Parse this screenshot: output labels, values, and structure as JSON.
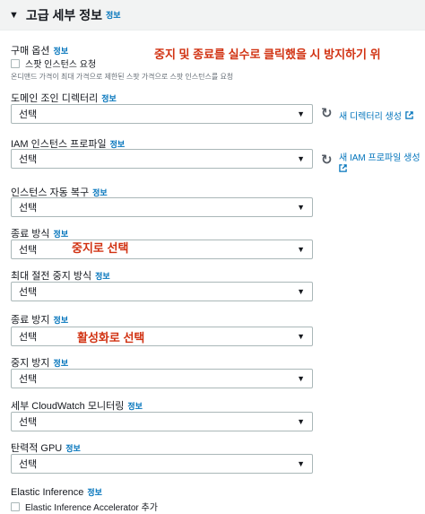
{
  "section": {
    "title": "고급 세부 정보",
    "info": "정보"
  },
  "purchase_option": {
    "label": "구매 옵션",
    "info": "정보",
    "checkbox_label": "스팟 인스턴스 요청",
    "description": "온디맨드 가격이 최대 가격으로 제한된 스팟 가격으로 스팟 인스턴스를 요청"
  },
  "annotation_top": "중지 및 종료를 실수로 클릭했을 시 방지하기 위",
  "domain_join": {
    "label": "도메인 조인 디렉터리",
    "info": "정보",
    "value": "선택",
    "new_link": "새 디렉터리 생성"
  },
  "iam_profile": {
    "label": "IAM 인스턴스 프로파일",
    "info": "정보",
    "value": "선택",
    "new_link": "새 IAM 프로파일 생성"
  },
  "auto_recovery": {
    "label": "인스턴스 자동 복구",
    "info": "정보",
    "value": "선택"
  },
  "shutdown_behavior": {
    "label": "종료 방식",
    "info": "정보",
    "value": "선택",
    "annotation": "중지로 선택"
  },
  "hibernate_behavior": {
    "label": "최대 절전 중지 방식",
    "info": "정보",
    "value": "선택"
  },
  "termination_protection": {
    "label": "종료 방지",
    "info": "정보",
    "value": "선택",
    "annotation": "활성화로 선택"
  },
  "stop_protection": {
    "label": "중지 방지",
    "info": "정보",
    "value": "선택"
  },
  "detailed_monitoring": {
    "label": "세부 CloudWatch 모니터링",
    "info": "정보",
    "value": "선택"
  },
  "elastic_gpu": {
    "label": "탄력적 GPU",
    "info": "정보",
    "value": "선택"
  },
  "elastic_inference": {
    "label": "Elastic Inference",
    "info": "정보",
    "checkbox_label": "Elastic Inference Accelerator 추가"
  },
  "colors": {
    "info": "#0073bb",
    "annotation": "#d13212",
    "border": "#aab7b8"
  }
}
